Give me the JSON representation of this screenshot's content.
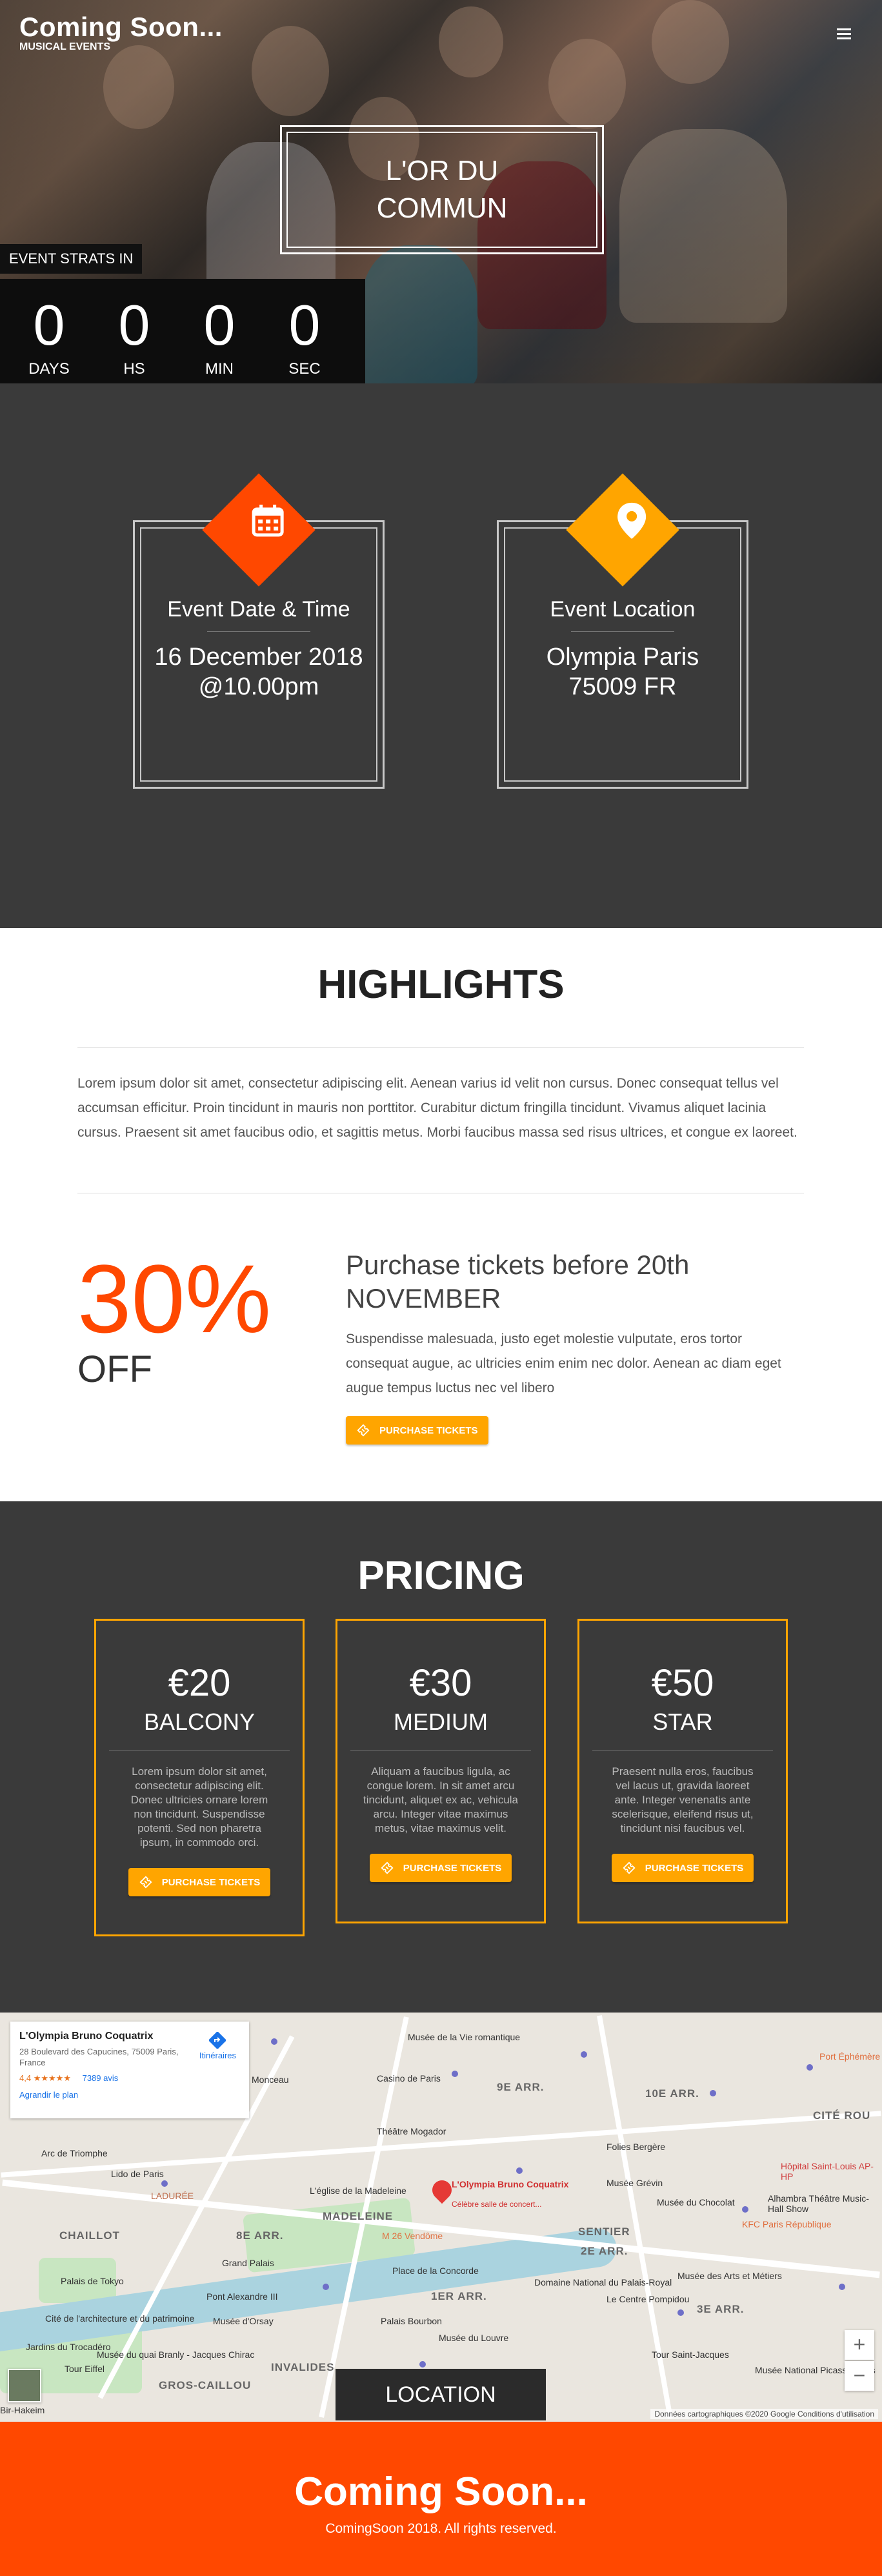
{
  "brand": {
    "title": "Coming Soon...",
    "subtitle": "MUSICAL EVENTS"
  },
  "hero": {
    "event_name": "L'OR DU COMMUN",
    "countdown_label": "EVENT STRATS IN",
    "countdown": [
      {
        "value": "0",
        "label": "DAYS"
      },
      {
        "value": "0",
        "label": "HS"
      },
      {
        "value": "0",
        "label": "MIN"
      },
      {
        "value": "0",
        "label": "SEC"
      }
    ]
  },
  "info": {
    "date": {
      "title": "Event Date & Time",
      "line1": "16 December 2018",
      "line2": "@10.00pm",
      "icon": "calendar-icon"
    },
    "location": {
      "title": "Event Location",
      "line1": "Olympia Paris",
      "line2": "75009 FR",
      "icon": "map-pin-icon"
    }
  },
  "highlights": {
    "title": "HIGHLIGHTS",
    "text": "Lorem ipsum dolor sit amet, consectetur adipiscing elit. Aenean varius id velit non cursus. Donec consequat tellus vel accumsan efficitur. Proin tincidunt in mauris non porttitor. Curabitur dictum fringilla tincidunt. Vivamus aliquet lacinia cursus. Praesent sit amet faucibus odio, et sagittis metus. Morbi faucibus massa sed risus ultrices, et congue ex laoreet.",
    "percent": "30%",
    "off": "OFF",
    "promo_title": "Purchase tickets before 20th NOVEMBER",
    "promo_text": "Suspendisse malesuada, justo eget molestie vulputate, eros tortor consequat augue, ac ultricies enim enim nec dolor. Aenean ac diam eget augue tempus luctus nec vel libero",
    "button": "PURCHASE TICKETS"
  },
  "pricing": {
    "title": "PRICING",
    "plans": [
      {
        "price": "€20",
        "name": "BALCONY",
        "desc": "Lorem ipsum dolor sit amet, consectetur adipiscing elit. Donec ultricies ornare lorem non tincidunt. Suspendisse potenti. Sed non pharetra ipsum, in commodo orci.",
        "button": "PURCHASE TICKETS"
      },
      {
        "price": "€30",
        "name": "MEDIUM",
        "desc": "Aliquam a faucibus ligula, ac congue lorem. In sit amet arcu tincidunt, aliquet ex ac, vehicula arcu. Integer vitae maximus metus, vitae maximus velit.",
        "button": "PURCHASE TICKETS"
      },
      {
        "price": "€50",
        "name": "STAR",
        "desc": "Praesent nulla eros, faucibus vel lacus ut, gravida laoreet ante. Integer venenatis ante scelerisque, eleifend risus ut, tincidunt nisi faucibus vel.",
        "button": "PURCHASE TICKETS"
      }
    ]
  },
  "map": {
    "card_name": "L'Olympia Bruno Coquatrix",
    "card_address": "28 Boulevard des Capucines, 75009 Paris, France",
    "rating": "4,4",
    "stars": "★★★★★",
    "reviews": "7389 avis",
    "enlarge": "Agrandir le plan",
    "directions": "Itinéraires",
    "pin_label": "L'Olympia Bruno Coquatrix",
    "pin_sub": "Célèbre salle de concert...",
    "districts": [
      "9E ARR.",
      "10E ARR.",
      "8E ARR.",
      "2E ARR.",
      "1ER ARR.",
      "3E ARR.",
      "CHAILLOT",
      "MADELEINE",
      "SENTIER",
      "CITÉ ROU",
      "GROS-CAILLOU",
      "INVALIDES"
    ],
    "places": [
      "Musée de la Vie romantique",
      "Casino de Paris",
      "Théâtre Mogador",
      "Folies Bergère",
      "Arc de Triomphe",
      "Lido de Paris",
      "LADURÉE",
      "L'église de la Madeleine",
      "Musée Grévin",
      "Musée du Chocolat",
      "Grand Palais",
      "Place de la Concorde",
      "M 26 Vendôme",
      "Domaine National du Palais-Royal",
      "Le Centre Pompidou",
      "Palais de Tokyo",
      "Pont Alexandre III",
      "Musée du Louvre",
      "Musée des Arts et Métiers",
      "Tour Eiffel",
      "Musée d'Orsay",
      "Hôpital Saint-Louis AP-HP",
      "Port Éphémère",
      "Alhambra Théâtre Music-Hall Show",
      "KFC Paris République",
      "Cité de l'architecture et du patrimoine",
      "Jardins du Trocadéro",
      "Musée du quai Branly - Jacques Chirac",
      "Tour Saint-Jacques",
      "Musée National Picasso-Paris",
      "Palais Bourbon",
      "Bir-Hakeim",
      "Monceau"
    ],
    "attribution": "Données cartographiques ©2020 Google    Conditions d'utilisation",
    "location_button": "LOCATION",
    "zoom_in": "+",
    "zoom_out": "−"
  },
  "footer": {
    "logo": "Coming Soon...",
    "copyright": "ComingSoon 2018. All rights reserved."
  },
  "colors": {
    "accent": "#ff4800",
    "gold": "#ffa500",
    "dark": "#3a3a3a"
  }
}
